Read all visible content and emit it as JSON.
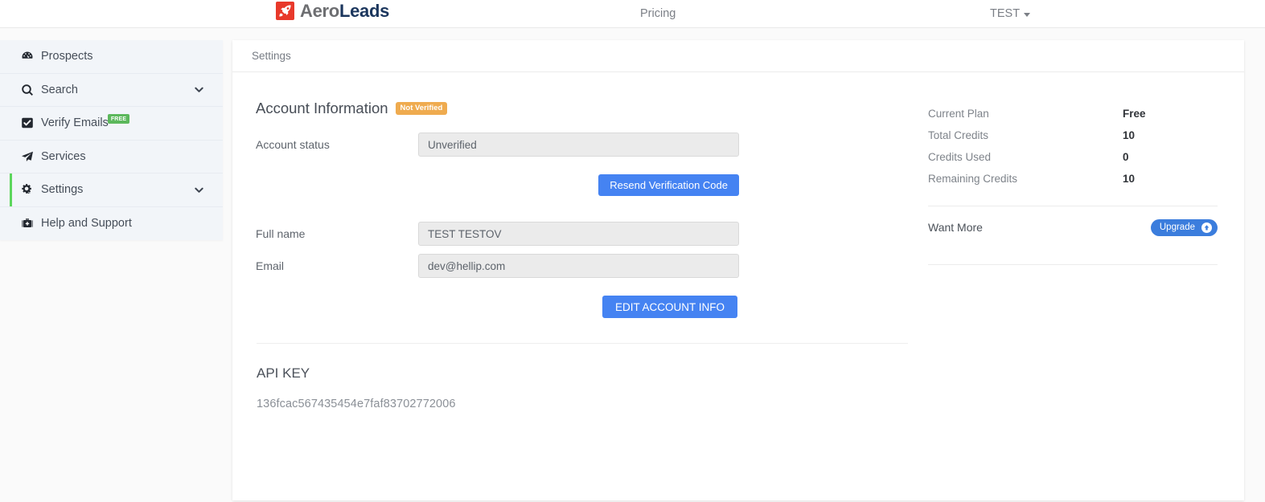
{
  "navbar": {
    "brand_aero": "Aero",
    "brand_leads": "Leads",
    "brand_icon": "rocket-icon",
    "pricing_label": "Pricing",
    "user_label": "TEST",
    "user_caret_icon": "caret-down-icon"
  },
  "sidebar": {
    "items": [
      {
        "label": "Prospects",
        "icon": "dashboard-icon",
        "badge": "",
        "chevron": false,
        "active": false
      },
      {
        "label": "Search",
        "icon": "search-icon",
        "badge": "",
        "chevron": true,
        "active": false
      },
      {
        "label": "Verify Emails",
        "icon": "check-square-icon",
        "badge": "FREE",
        "chevron": false,
        "active": false
      },
      {
        "label": "Services",
        "icon": "paper-plane-icon",
        "badge": "",
        "chevron": false,
        "active": false
      },
      {
        "label": "Settings",
        "icon": "gears-icon",
        "badge": "",
        "chevron": true,
        "active": true
      },
      {
        "label": "Help and Support",
        "icon": "briefcase-icon",
        "badge": "",
        "chevron": false,
        "active": false
      }
    ]
  },
  "breadcrumb": {
    "label": "Settings"
  },
  "account": {
    "section_title": "Account Information",
    "status_badge": "Not Verified",
    "fields": {
      "status_label": "Account status",
      "status_value": "Unverified",
      "fullname_label": "Full name",
      "fullname_value": "TEST TESTOV",
      "email_label": "Email",
      "email_value": "dev@hellip.com"
    },
    "resend_button": "Resend Verification Code",
    "edit_button": "EDIT ACCOUNT INFO"
  },
  "api": {
    "title": "API KEY",
    "key": "136fcac567435454e7faf83702772006"
  },
  "plan_panel": {
    "rows": [
      {
        "label": "Current Plan",
        "value": "Free"
      },
      {
        "label": "Total Credits",
        "value": "10"
      },
      {
        "label": "Credits Used",
        "value": "0"
      },
      {
        "label": "Remaining Credits",
        "value": "10"
      }
    ],
    "want_more_label": "Want More",
    "upgrade_button": "Upgrade",
    "upgrade_icon": "arrow-up-circle-icon"
  },
  "colors": {
    "brand_red": "#e8392b",
    "brand_navy": "#1b365d",
    "primary_blue": "#4583f2",
    "upgrade_blue": "#3b7ddd",
    "warn_orange": "#efab4f",
    "free_green": "#5cb85c",
    "active_green": "#5cd65c",
    "sidebar_bg": "#f2f5f9"
  }
}
